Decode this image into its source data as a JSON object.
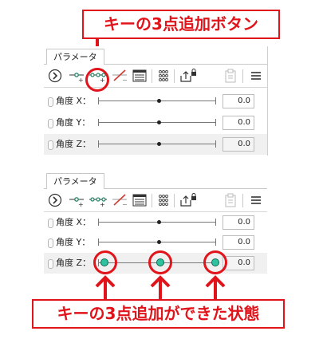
{
  "callouts": {
    "top": "キーの3点追加ボタン",
    "bottom": "キーの3点追加ができた状態"
  },
  "colors": {
    "annotation_red": "#e0141a",
    "keyframe_green": "#2ec29e",
    "keyframe_border": "#0c6b55"
  },
  "panel_top": {
    "tab": "パラメータ",
    "toolbar": [
      {
        "name": "navigate-icon"
      },
      {
        "name": "add-key-icon"
      },
      {
        "name": "add-three-keys-icon"
      },
      {
        "name": "delete-key-icon"
      },
      {
        "name": "keyframe-window-icon"
      },
      {
        "name": "dots-grid-icon"
      },
      {
        "name": "export-lock-icon"
      },
      {
        "name": "paste-icon"
      },
      {
        "name": "menu-icon"
      }
    ],
    "rows": [
      {
        "label": "角度 X：",
        "value": "0.0"
      },
      {
        "label": "角度 Y：",
        "value": "0.0"
      },
      {
        "label": "角度 Z：",
        "value": "0.0"
      }
    ]
  },
  "panel_bottom": {
    "tab": "パラメータ",
    "rows": [
      {
        "label": "角度 X：",
        "value": "0.0"
      },
      {
        "label": "角度 Y：",
        "value": "0.0"
      },
      {
        "label": "角度 Z：",
        "value": "0.0"
      }
    ]
  }
}
